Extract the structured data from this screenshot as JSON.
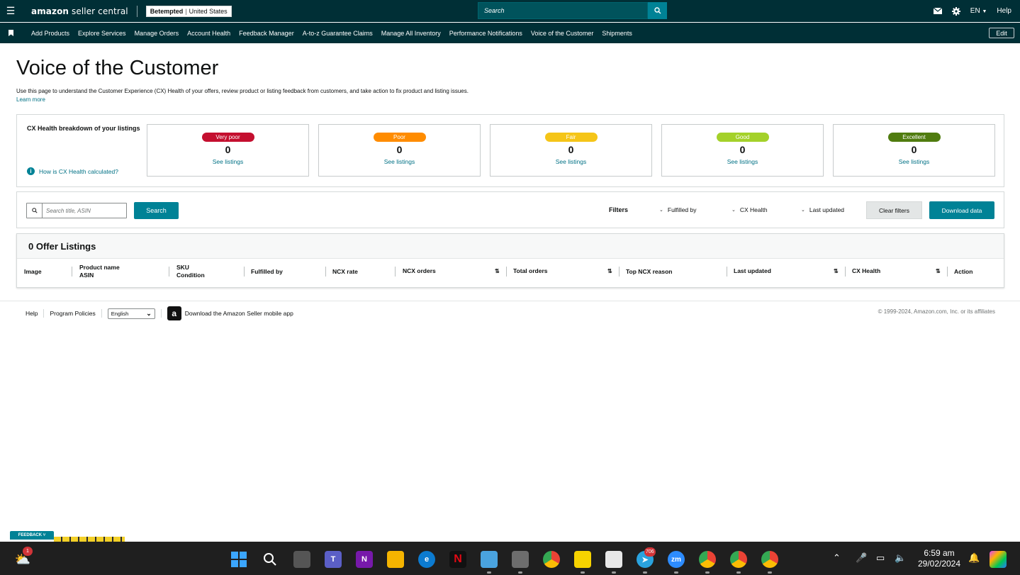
{
  "topbar": {
    "logo_main": "amazon",
    "logo_sub": "seller central",
    "store_name": "Betempted",
    "store_region": "United States",
    "search_placeholder": "Search",
    "language": "EN",
    "help": "Help"
  },
  "nav": {
    "items": [
      "Add Products",
      "Explore Services",
      "Manage Orders",
      "Account Health",
      "Feedback Manager",
      "A-to-z Guarantee Claims",
      "Manage All Inventory",
      "Performance Notifications",
      "Voice of the Customer",
      "Shipments"
    ],
    "edit": "Edit"
  },
  "page": {
    "title": "Voice of the Customer",
    "description": "Use this page to understand the Customer Experience (CX) Health of your offers, review product or listing feedback from customers, and take action to fix product and listing issues.",
    "learn_more": "Learn more"
  },
  "cx": {
    "label": "CX Health breakdown of your listings",
    "info_link": "How is CX Health calculated?",
    "cards": [
      {
        "label": "Very poor",
        "count": "0",
        "link": "See listings",
        "color": "#c40f2f"
      },
      {
        "label": "Poor",
        "count": "0",
        "link": "See listings",
        "color": "#ff8c00"
      },
      {
        "label": "Fair",
        "count": "0",
        "link": "See listings",
        "color": "#f5c518"
      },
      {
        "label": "Good",
        "count": "0",
        "link": "See listings",
        "color": "#a4d12a"
      },
      {
        "label": "Excellent",
        "count": "0",
        "link": "See listings",
        "color": "#507c0f"
      }
    ]
  },
  "filters": {
    "search_placeholder": "Search title, ASIN",
    "search_button": "Search",
    "label": "Filters",
    "fulfilled_by": "Fulfilled by",
    "cx_health": "CX Health",
    "last_updated": "Last updated",
    "clear": "Clear filters",
    "download": "Download data"
  },
  "table": {
    "count_label": "0 Offer Listings",
    "columns": {
      "image": "Image",
      "product_name": "Product name",
      "asin": "ASIN",
      "sku": "SKU",
      "condition": "Condition",
      "fulfilled_by": "Fulfilled by",
      "ncx_rate": "NCX rate",
      "ncx_orders": "NCX orders",
      "total_orders": "Total orders",
      "top_ncx_reason": "Top NCX reason",
      "last_updated": "Last updated",
      "cx_health": "CX Health",
      "action": "Action"
    }
  },
  "footer": {
    "help": "Help",
    "policies": "Program Policies",
    "language": "English",
    "app_link": "Download the Amazon Seller mobile app",
    "copyright": "© 1999-2024, Amazon.com, Inc. or its affiliates"
  },
  "feedback_tab": "FEEDBACK",
  "taskbar": {
    "weather_badge": "1",
    "telegram_badge": "706",
    "time": "6:59 am",
    "date": "29/02/2024"
  }
}
